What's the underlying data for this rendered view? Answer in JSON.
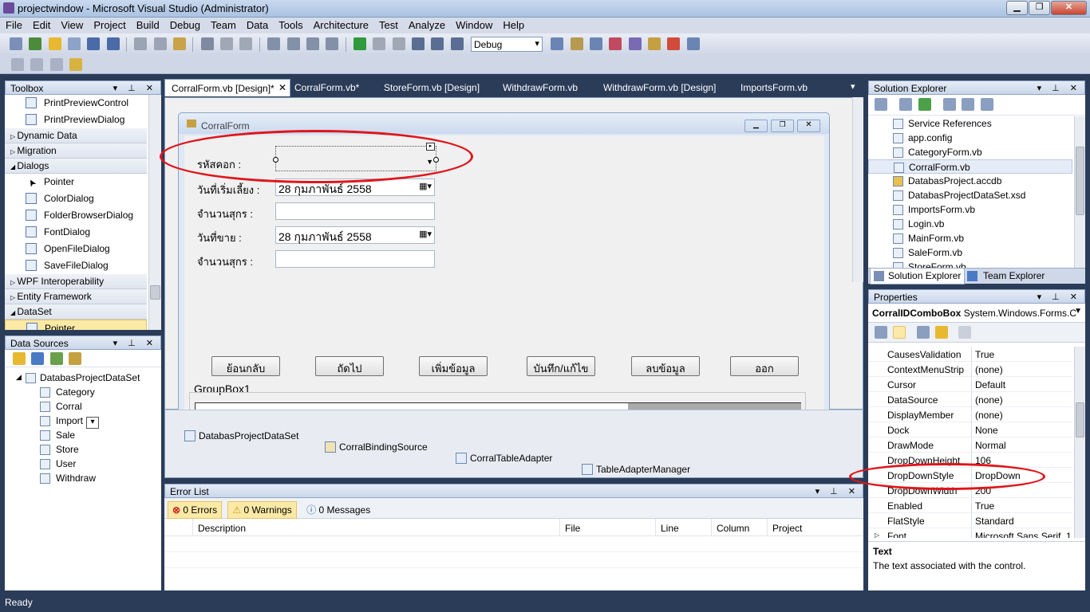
{
  "window": {
    "title": "projectwindow - Microsoft Visual Studio (Administrator)",
    "controls": [
      "▁",
      "❐",
      "✕"
    ]
  },
  "menu": [
    "File",
    "Edit",
    "View",
    "Project",
    "Build",
    "Debug",
    "Team",
    "Data",
    "Tools",
    "Architecture",
    "Test",
    "Analyze",
    "Window",
    "Help"
  ],
  "toolbar": {
    "config": "Debug"
  },
  "toolbox": {
    "title": "Toolbox",
    "items": [
      {
        "type": "item",
        "label": "PrintPreviewControl"
      },
      {
        "type": "item",
        "label": "PrintPreviewDialog"
      },
      {
        "type": "group",
        "label": "Dynamic Data",
        "expanded": false
      },
      {
        "type": "group",
        "label": "Migration",
        "expanded": false
      },
      {
        "type": "group",
        "label": "Dialogs",
        "expanded": true
      },
      {
        "type": "item",
        "label": "Pointer",
        "icon": "pointer-icon"
      },
      {
        "type": "item",
        "label": "ColorDialog"
      },
      {
        "type": "item",
        "label": "FolderBrowserDialog"
      },
      {
        "type": "item",
        "label": "FontDialog"
      },
      {
        "type": "item",
        "label": "OpenFileDialog"
      },
      {
        "type": "item",
        "label": "SaveFileDialog"
      },
      {
        "type": "group",
        "label": "WPF Interoperability",
        "expanded": false
      },
      {
        "type": "group",
        "label": "Entity Framework",
        "expanded": false
      },
      {
        "type": "group",
        "label": "DataSet",
        "expanded": true
      },
      {
        "type": "item",
        "label": "Pointer",
        "selected": true
      }
    ]
  },
  "data_sources": {
    "title": "Data Sources",
    "dataset": "DatabasProjectDataSet",
    "tables": [
      "Category",
      "Corral",
      "Import",
      "Sale",
      "Store",
      "User",
      "Withdraw"
    ]
  },
  "tabs": [
    {
      "label": "CorralForm.vb [Design]*",
      "active": true
    },
    {
      "label": "CorralForm.vb*"
    },
    {
      "label": "StoreForm.vb [Design]"
    },
    {
      "label": "WithdrawForm.vb"
    },
    {
      "label": "WithdrawForm.vb [Design]"
    },
    {
      "label": "ImportsForm.vb"
    }
  ],
  "form": {
    "title": "CorralForm",
    "labels": {
      "corral_id": "รหัสคอก :",
      "start_date": "วันที่เริ่มเลี้ยง :",
      "pig_count": "จำนวนสุกร :",
      "sale_date": "วันที่ขาย :",
      "pig_count2": "จำนวนสุกร :"
    },
    "start_date_value": "28  กุมภาพันธ์   2558",
    "sale_date_value": "28  กุมภาพันธ์   2558",
    "buttons": [
      "ย้อนกลับ",
      "ถัดไป",
      "เพิ่มข้อมูล",
      "บันทึก/แก้ไข",
      "ลบข้อมูล",
      "ออก"
    ],
    "groupbox": "GroupBox1"
  },
  "tray": [
    "DatabasProjectDataSet",
    "CorralBindingSource",
    "CorralTableAdapter",
    "TableAdapterManager"
  ],
  "error_list": {
    "title": "Error List",
    "errors": "0 Errors",
    "warnings": "0 Warnings",
    "messages": "0 Messages",
    "columns": [
      "Description",
      "File",
      "Line",
      "Column",
      "Project"
    ]
  },
  "solution_explorer": {
    "title": "Solution Explorer",
    "items": [
      "Service References",
      "app.config",
      "CategoryForm.vb",
      "CorralForm.vb",
      "DatabasProject.accdb",
      "DatabasProjectDataSet.xsd",
      "ImportsForm.vb",
      "Login.vb",
      "MainForm.vb",
      "SaleForm.vb",
      "StoreForm.vb"
    ],
    "selected": "CorralForm.vb",
    "tabs": [
      "Solution Explorer",
      "Team Explorer"
    ]
  },
  "properties": {
    "title": "Properties",
    "object_name": "CorralIDComboBox",
    "object_type": "System.Windows.Forms.C",
    "rows": [
      {
        "name": "CausesValidation",
        "value": "True"
      },
      {
        "name": "ContextMenuStrip",
        "value": "(none)"
      },
      {
        "name": "Cursor",
        "value": "Default"
      },
      {
        "name": "DataSource",
        "value": "(none)"
      },
      {
        "name": "DisplayMember",
        "value": "(none)"
      },
      {
        "name": "Dock",
        "value": "None"
      },
      {
        "name": "DrawMode",
        "value": "Normal"
      },
      {
        "name": "DropDownHeight",
        "value": "106"
      },
      {
        "name": "DropDownStyle",
        "value": "DropDown"
      },
      {
        "name": "DropDownWidth",
        "value": "200"
      },
      {
        "name": "Enabled",
        "value": "True"
      },
      {
        "name": "FlatStyle",
        "value": "Standard"
      },
      {
        "name": "Font",
        "value": "Microsoft Sans Serif, 1:"
      }
    ],
    "desc_title": "Text",
    "desc_text": "The text associated with the control."
  },
  "status": {
    "text": "Ready"
  },
  "colors": {
    "accent": "#e0151b",
    "ide_background": "#2b3c59",
    "selection": "#fbe9a6"
  }
}
